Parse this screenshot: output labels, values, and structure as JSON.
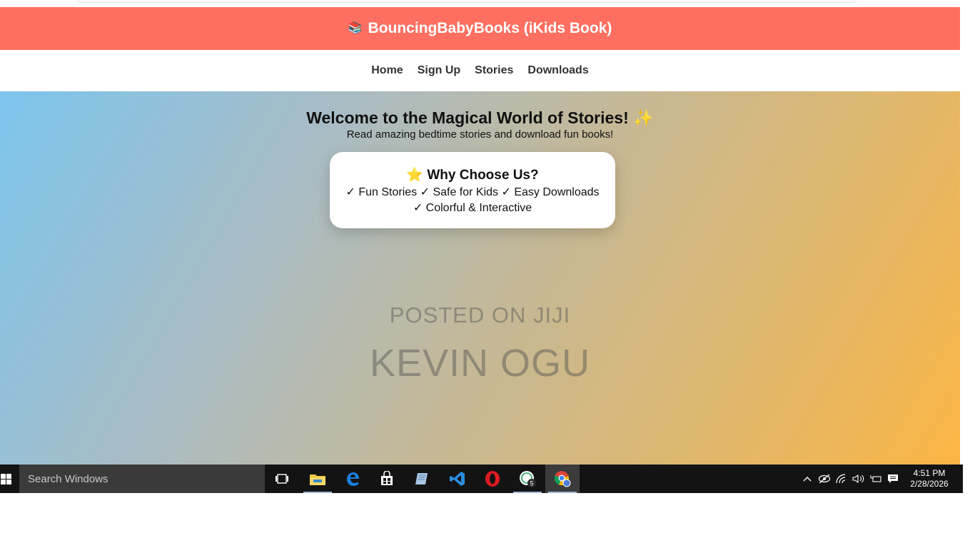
{
  "site": {
    "title": "BouncingBabyBooks (iKids Book)",
    "header_color": "#ff6f61",
    "books_icon": "📚"
  },
  "nav": {
    "items": [
      {
        "label": "Home"
      },
      {
        "label": "Sign Up"
      },
      {
        "label": "Stories"
      },
      {
        "label": "Downloads"
      }
    ]
  },
  "hero": {
    "title": "Welcome to the Magical World of Stories!",
    "sparkle": "✨",
    "subtitle": "Read amazing bedtime stories and download fun books!",
    "gradient_colors": [
      "#7cc5ed",
      "#fbb544"
    ]
  },
  "why_card": {
    "star": "⭐",
    "title": "Why Choose Us?",
    "line1": "✓ Fun Stories ✓ Safe for Kids ✓ Easy Downloads",
    "line2": "✓ Colorful & Interactive"
  },
  "watermark": {
    "line1": "POSTED ON JIJI",
    "line2": "KEVIN OGU"
  },
  "taskbar": {
    "search_placeholder": "Search Windows",
    "pinned_apps": [
      "task-view-icon",
      "file-explorer-icon",
      "edge-icon",
      "store-icon",
      "notepad-icon",
      "vscode-icon",
      "opera-icon",
      "whatsapp-icon",
      "chrome-icon"
    ],
    "whatsapp_badge": "5",
    "clock_time": "4:51 PM",
    "clock_date": "2/28/2026"
  }
}
